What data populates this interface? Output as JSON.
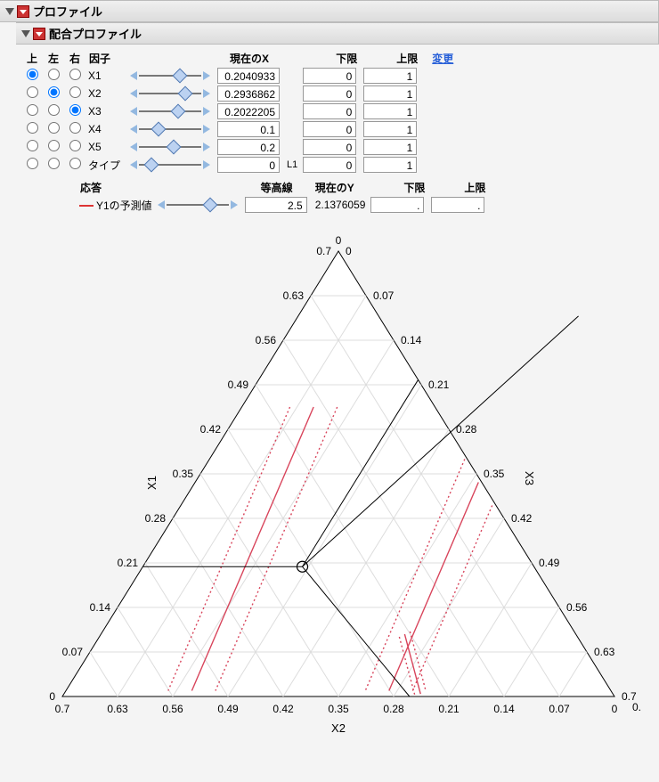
{
  "panel": {
    "title": "プロファイル",
    "subTitle": "配合プロファイル"
  },
  "columns": {
    "up": "上",
    "left": "左",
    "right": "右",
    "factor": "因子",
    "currentX": "現在のX",
    "lower": "下限",
    "upper": "上限",
    "change": "変更",
    "response": "応答",
    "contour": "等高線",
    "currentY": "現在のY"
  },
  "factors": [
    {
      "name": "X1",
      "radio": 0,
      "sliderPos": 42,
      "currentX": "0.2040933",
      "lower": "0",
      "upper": "1"
    },
    {
      "name": "X2",
      "radio": 1,
      "sliderPos": 48,
      "currentX": "0.2936862",
      "lower": "0",
      "upper": "1"
    },
    {
      "name": "X3",
      "radio": 2,
      "sliderPos": 40,
      "currentX": "0.2022205",
      "lower": "0",
      "upper": "1"
    },
    {
      "name": "X4",
      "radio": -1,
      "sliderPos": 18,
      "currentX": "0.1",
      "lower": "0",
      "upper": "1"
    },
    {
      "name": "X5",
      "radio": -1,
      "sliderPos": 35,
      "currentX": "0.2",
      "lower": "0",
      "upper": "1"
    },
    {
      "name": "タイプ",
      "radio": -1,
      "sliderPos": 10,
      "currentX": "0",
      "lower": "0",
      "upper": "1",
      "extra": "L1"
    }
  ],
  "response": {
    "name": "Y1の予測値",
    "sliderPos": 45,
    "contour": "2.5",
    "currentY": "2.1376059",
    "lower": ".",
    "upper": "."
  },
  "chart_data": {
    "type": "ternary",
    "axes": {
      "top": "X1",
      "left": "X2",
      "right": "X3"
    },
    "axisRange": [
      0,
      0.7
    ],
    "leftTicks": [
      0,
      0.07,
      0.14,
      0.21,
      0.28,
      0.35,
      0.42,
      0.49,
      0.56,
      0.63,
      0.7
    ],
    "rightTicks": [
      0,
      0.07,
      0.14,
      0.21,
      0.28,
      0.35,
      0.42,
      0.49,
      0.56,
      0.63,
      0.7
    ],
    "bottomTicks": [
      0.7,
      0.63,
      0.56,
      0.49,
      0.42,
      0.35,
      0.28,
      0.21,
      0.14,
      0.07,
      0
    ],
    "topLabel": "0",
    "bottomRightLabel": "0.7",
    "cursor": {
      "X1": 0.2040933,
      "X2": 0.2936862,
      "X3": 0.2022205
    },
    "contours": [
      {
        "value": "~−σ",
        "color": "#d8445b",
        "style": "dotted"
      },
      {
        "value": "2.5",
        "color": "#d8445b",
        "style": "solid"
      },
      {
        "value": "~+σ",
        "color": "#d8445b",
        "style": "dotted"
      }
    ],
    "guidelines": [
      {
        "type": "horizontal",
        "value": 0.21
      },
      {
        "type": "toRight",
        "from": "cursor"
      },
      {
        "type": "toBottom",
        "from": "cursor"
      }
    ]
  }
}
